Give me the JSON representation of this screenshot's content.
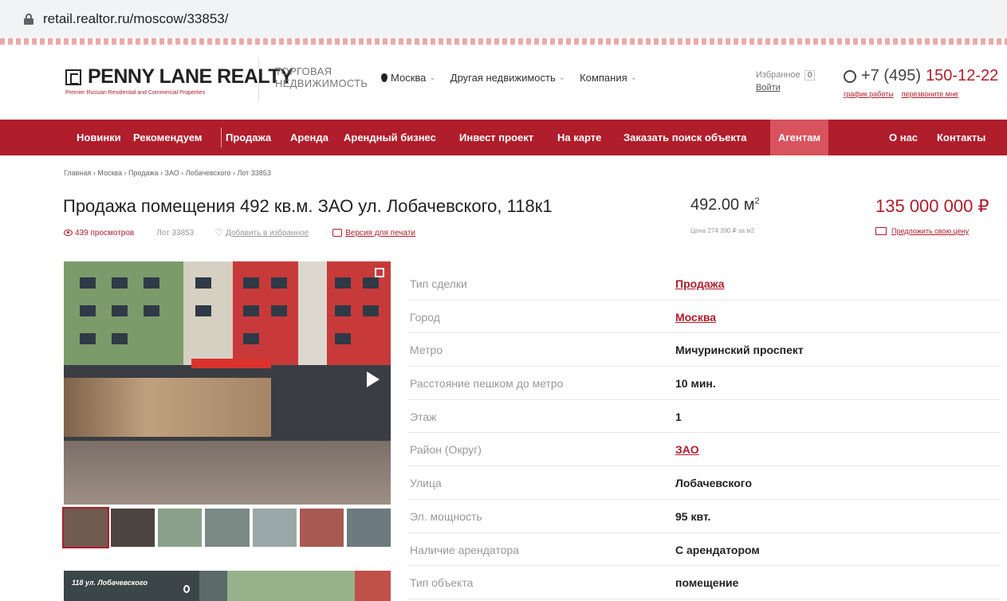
{
  "browser": {
    "url": "retail.realtor.ru/moscow/33853/"
  },
  "header": {
    "logo_name": "PENNY LANE REALTY",
    "logo_tagline": "Premier Russian Residential and Commercial Properties",
    "category_line1": "ТОРГОВАЯ",
    "category_line2": "НЕДВИЖИМОСТЬ",
    "nav": [
      {
        "label": "Москва"
      },
      {
        "label": "Другая недвижимость"
      },
      {
        "label": "Компания"
      }
    ],
    "favorites_label": "Избранное",
    "favorites_count": "0",
    "login_label": "Войти",
    "phone_prefix": "+7 (495)",
    "phone_number": "150-12-22",
    "schedule_label": "график работы",
    "callback_label": "перезвоните мне"
  },
  "main_nav": [
    {
      "label": "Новинки"
    },
    {
      "label": "Рекомендуем"
    },
    {
      "label": "Продажа"
    },
    {
      "label": "Аренда"
    },
    {
      "label": "Арендный бизнес"
    },
    {
      "label": "Инвест проект"
    },
    {
      "label": "На карте"
    },
    {
      "label": "Заказать поиск объекта"
    },
    {
      "label": "Агентам"
    },
    {
      "label": "О нас"
    },
    {
      "label": "Контакты"
    }
  ],
  "breadcrumb": "Главная › Москва › Продажа › ЗАО › Лобачевского › Лот 33853",
  "listing": {
    "title": "Продажа помещения 492 кв.м. ЗАО ул. Лобачевского, 118к1",
    "views": "439 просмотров",
    "lot": "Лот 33853",
    "add_favorite": "Добавить в избранное",
    "print_version": "Версия для печати",
    "area_value": "492.00 м",
    "area_unit_sup": "2",
    "price_per_m2": "Цена 274 390 ₽ за м2",
    "price": "135 000 000 ₽",
    "offer_price": "Предложить свою цену",
    "photo2_caption": "118 ул. Лобачевского"
  },
  "properties": [
    {
      "label": "Тип сделки",
      "value": "Продажа"
    },
    {
      "label": "Город",
      "value": "Москва"
    },
    {
      "label": "Метро",
      "value": "Мичуринский проспект"
    },
    {
      "label": "Расстояние пешком до метро",
      "value": "10 мин."
    },
    {
      "label": "Этаж",
      "value": "1"
    },
    {
      "label": "Район (Округ)",
      "value": "ЗАО"
    },
    {
      "label": "Улица",
      "value": "Лобачевского"
    },
    {
      "label": "Эл. мощность",
      "value": "95 квт."
    },
    {
      "label": "Наличие арендатора",
      "value": "С арендатором"
    },
    {
      "label": "Тип объекта",
      "value": "помещение"
    }
  ],
  "colors": {
    "brand": "#b01d2b",
    "nav_active": "#d9535e"
  }
}
